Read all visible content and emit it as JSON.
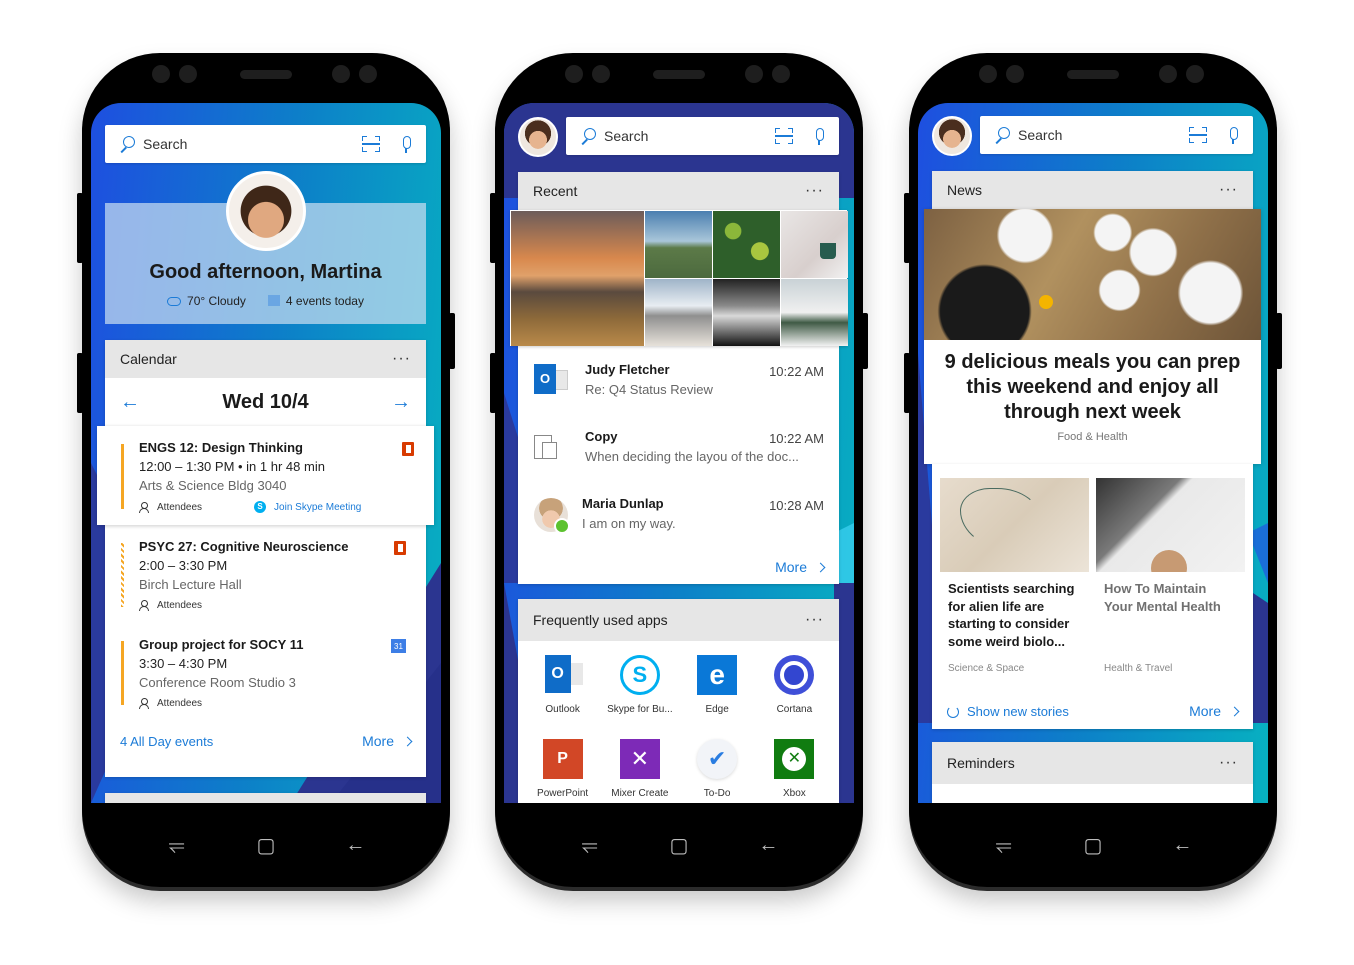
{
  "colors": {
    "accent": "#1b7bd7",
    "screen_gradient": [
      "#1e4fe0",
      "#0d7ec9",
      "#07b1c1"
    ],
    "bg_dark_shape": "#2b3590",
    "event_bar": "#f5a623",
    "office_red": "#d83b01"
  },
  "phones": [
    {
      "search": {
        "placeholder": "Search",
        "icons": [
          "search-icon",
          "scan-icon",
          "mic-icon"
        ]
      },
      "greeting": {
        "title": "Good afternoon, Martina",
        "weather": "70° Cloudy",
        "events": "4 events today"
      },
      "calendar": {
        "header": "Calendar",
        "menu": "···",
        "date": "Wed 10/4",
        "prev_icon": "←",
        "next_icon": "→",
        "events": [
          {
            "title": "ENGS 12: Design Thinking",
            "time": "12:00 – 1:30 PM • in 1 hr 48 min",
            "location": "Arts & Science Bldg 3040",
            "attendees": "Attendees",
            "skype_link": "Join Skype Meeting",
            "source": "office-icon"
          },
          {
            "title": "PSYC 27: Cognitive Neuroscience",
            "time": "2:00 – 3:30 PM",
            "location": "Birch Lecture Hall",
            "attendees": "Attendees",
            "source": "office-icon"
          },
          {
            "title": "Group project for SOCY 11",
            "time": "3:30 – 4:30 PM",
            "location": "Conference Room Studio 3",
            "attendees": "Attendees",
            "source": "google-calendar-icon",
            "source_label": "31"
          }
        ],
        "all_day": "4 All Day events",
        "more": "More"
      },
      "nav": {
        "recents": "recents-icon",
        "home": "home-icon",
        "back": "back-icon"
      }
    },
    {
      "search": {
        "placeholder": "Search"
      },
      "recent": {
        "header": "Recent",
        "menu": "···",
        "photos": [
          "sunset beach",
          "green field",
          "green foliage",
          "mug on blanket",
          "snowy road",
          "dark clouds",
          "snowy trees"
        ],
        "activities": [
          {
            "name": "Judy Fletcher",
            "subtitle": "Re: Q4 Status Review",
            "time": "10:22 AM",
            "icon": "outlook-icon"
          },
          {
            "name": "Copy",
            "subtitle": "When deciding the layou of the doc...",
            "time": "10:22 AM",
            "icon": "clipboard-icon"
          },
          {
            "name": "Maria Dunlap",
            "subtitle": "I am on my way.",
            "time": "10:28 AM",
            "icon": "contact-avatar"
          }
        ],
        "more": "More"
      },
      "apps": {
        "header": "Frequently used apps",
        "menu": "···",
        "items": [
          {
            "label": "Outlook",
            "glyph": "O"
          },
          {
            "label": "Skype for Bu...",
            "glyph": "S"
          },
          {
            "label": "Edge",
            "glyph": "e"
          },
          {
            "label": "Cortana",
            "glyph": ""
          },
          {
            "label": "PowerPoint",
            "glyph": "P"
          },
          {
            "label": "Mixer Create",
            "glyph": "✕"
          },
          {
            "label": "To-Do",
            "glyph": "✔"
          },
          {
            "label": "Xbox",
            "glyph": ""
          }
        ]
      }
    },
    {
      "search": {
        "placeholder": "Search"
      },
      "news": {
        "header": "News",
        "menu": "···",
        "hero": {
          "title": "9 delicious meals you can prep this weekend and enjoy all through next week",
          "category": "Food & Health"
        },
        "stories": [
          {
            "title": "Scientists searching for alien life are starting to consider some weird biolo...",
            "category": "Science & Space"
          },
          {
            "title": "How To Maintain Your Mental Health",
            "category": "Health & Travel"
          }
        ],
        "show_new": "Show new stories",
        "more": "More"
      },
      "reminders": {
        "header": "Reminders",
        "menu": "···"
      }
    }
  ]
}
